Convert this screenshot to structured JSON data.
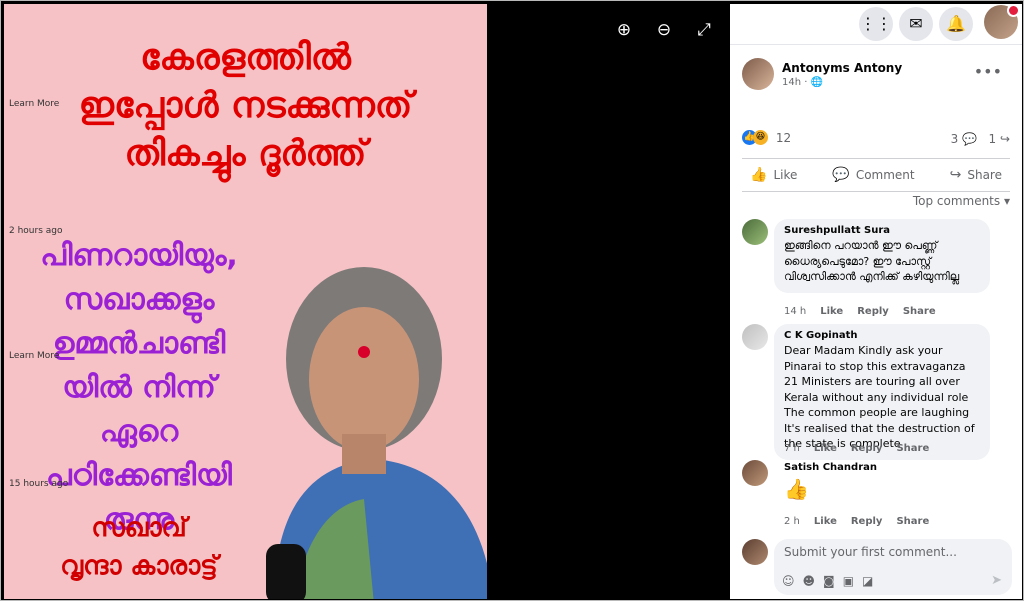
{
  "poster": {
    "title_lines": [
      "കേരളത്തിൽ",
      "ഇപ്പോൾ നടക്കുന്നത്",
      "തികച്ചും ദൂർത്ത്"
    ],
    "middle_lines": [
      "പിണറായിയും,",
      "സഖാക്കളും",
      "ഉമ്മൻചാണ്ടി",
      "യിൽ നിന്ന്",
      "ഏറെ",
      "പഠിക്കേണ്ടിയി",
      "രുന്നു"
    ],
    "sign_lines": [
      "സഖാവ്",
      "വൃന്ദാ കാരാട്ട്"
    ]
  },
  "overlays": [
    "Learn More",
    "2 hours ago",
    "Learn More",
    "15 hours ago"
  ],
  "viewer_tools": {
    "zoom_in": "⊕",
    "zoom_out": "⊖",
    "fullscreen": "⤢"
  },
  "post": {
    "author": "Antonyms Antony",
    "time": "14h",
    "privacy_icon": "globe-icon",
    "reactions_count": "12",
    "comments_count": "3",
    "shares_count": "1",
    "actions": {
      "like": "Like",
      "comment": "Comment",
      "share": "Share"
    },
    "sort_label": "Top comments"
  },
  "comments": [
    {
      "name": "Sureshpullatt Sura",
      "text": "ഇങ്ങിനെ പറയാൻ ഈ പെണ്ണ് ധൈര്യപെടുമോ? ഈ പോസ്റ്റ് വിശ്വസിക്കാൻ എനിക്ക് കഴിയുന്നില്ല",
      "time": "14 h",
      "like": "Like",
      "reply": "Reply",
      "share": "Share"
    },
    {
      "name": "C K Gopinath",
      "text": "Dear Madam Kindly ask your Pinarai to stop this extravaganza 21 Ministers are touring all over Kerala without any individual role The common people are laughing It's realised that the destruction of the state is complete",
      "time": "7 h",
      "like": "Like",
      "reply": "Reply",
      "share": "Share"
    },
    {
      "name": "Satish Chandran",
      "text": "👍",
      "time": "2 h",
      "like": "Like",
      "reply": "Reply",
      "share": "Share"
    }
  ],
  "composer": {
    "placeholder": "Submit your first comment..."
  },
  "colors": {
    "accent": "#1877f2",
    "poster_bg": "#f6c2c6",
    "title_red": "#e00000",
    "middle_purple": "#9b22d4"
  }
}
